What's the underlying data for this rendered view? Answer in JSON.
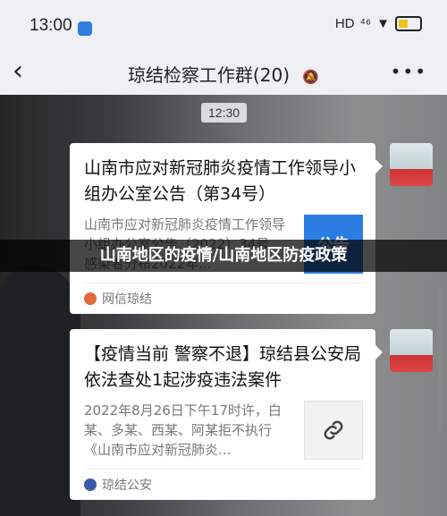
{
  "status": {
    "time": "13:00",
    "network": "HD",
    "signal": "⁴⁶",
    "wifi": "▼"
  },
  "nav": {
    "back_icon": "‹",
    "title": "琼结检察工作群(20)",
    "mute_icon": "🔕",
    "more_icon": "•••"
  },
  "chat": {
    "timestamp": "12:30",
    "messages": [
      {
        "title": "山南市应对新冠肺炎疫情工作领导小组办公室公告（第34号）",
        "desc": "山南市应对新冠肺炎疫情工作领导小组办公室公告（2022）34号 ...感染者分布2022年...",
        "thumb_text": "公告",
        "source": "网信琼结"
      },
      {
        "title": "【疫情当前 警察不退】琼结县公安局依法查处1起涉疫违法案件",
        "desc": "2022年8月26日下午17时许，白某、多某、西某、阿某拒不执行《山南市应对新冠肺炎...",
        "thumb_icon": "🔗",
        "source": "琼结公安"
      }
    ]
  },
  "overlay": {
    "caption": "山南地区的疫情/山南地区防疫政策"
  },
  "colors": {
    "accent": "#2c7de3",
    "bar_bg": "#eef0f4"
  }
}
